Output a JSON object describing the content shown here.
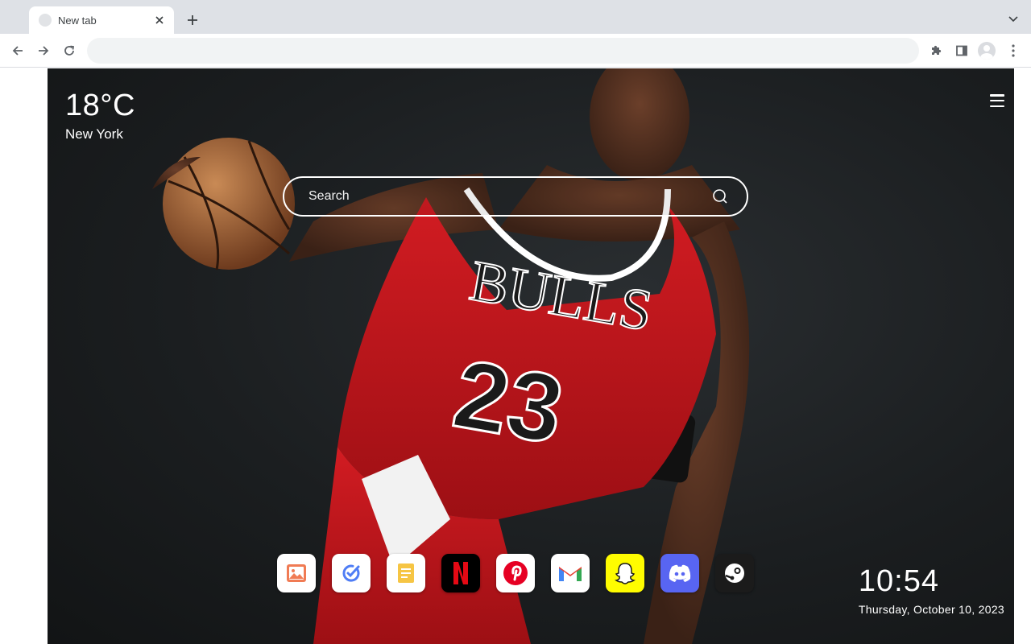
{
  "browser": {
    "tab": {
      "title": "New tab"
    },
    "address_bar": {
      "value": "",
      "placeholder": ""
    }
  },
  "weather": {
    "temperature": "18°C",
    "city": "New York"
  },
  "search": {
    "placeholder": "Search"
  },
  "dock": {
    "apps": [
      {
        "name": "gallery",
        "bg": "#ffffff"
      },
      {
        "name": "tasks",
        "bg": "#ffffff"
      },
      {
        "name": "notes",
        "bg": "#ffffff"
      },
      {
        "name": "netflix",
        "bg": "#000000",
        "accent": "#e50914"
      },
      {
        "name": "pinterest",
        "bg": "#ffffff",
        "accent": "#e60023"
      },
      {
        "name": "gmail",
        "bg": "#ffffff",
        "accent": "#ea4335"
      },
      {
        "name": "snapchat",
        "bg": "#fffc00"
      },
      {
        "name": "discord",
        "bg": "#5865f2"
      },
      {
        "name": "steam",
        "bg": "#1b1b1b"
      }
    ]
  },
  "clock": {
    "time": "10:54",
    "date": "Thursday, October 10, 2023"
  },
  "colors": {
    "tabstrip": "#dee1e6",
    "jersey_red": "#c0141b",
    "background": "#1b1e20"
  }
}
